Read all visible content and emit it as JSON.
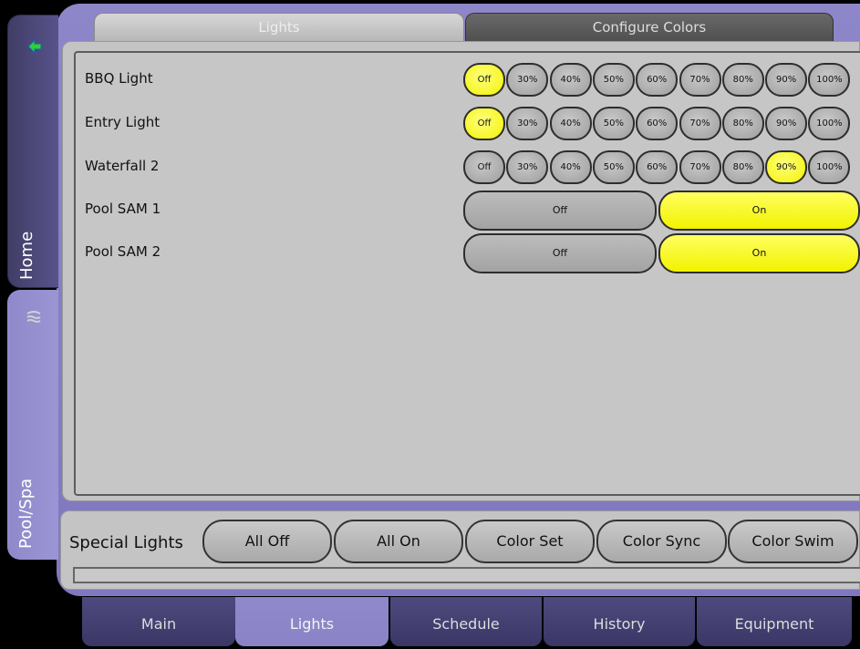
{
  "sidebar": {
    "home_label": "Home",
    "pool_label": "Pool/Spa",
    "home_icon": "arrow-icon",
    "pool_icon": "pool-icon"
  },
  "tabs": {
    "lights": "Lights",
    "configure_colors": "Configure Colors"
  },
  "lights": [
    {
      "name": "BBQ Light",
      "type": "dimmer",
      "options": [
        "Off",
        "30%",
        "40%",
        "50%",
        "60%",
        "70%",
        "80%",
        "90%",
        "100%"
      ],
      "selected": "Off"
    },
    {
      "name": "Entry Light",
      "type": "dimmer",
      "options": [
        "Off",
        "30%",
        "40%",
        "50%",
        "60%",
        "70%",
        "80%",
        "90%",
        "100%"
      ],
      "selected": "Off"
    },
    {
      "name": "Waterfall 2",
      "type": "dimmer",
      "options": [
        "Off",
        "30%",
        "40%",
        "50%",
        "60%",
        "70%",
        "80%",
        "90%",
        "100%"
      ],
      "selected": "90%"
    },
    {
      "name": "Pool SAM 1",
      "type": "switch",
      "options": [
        "Off",
        "On"
      ],
      "selected": "On"
    },
    {
      "name": "Pool SAM 2",
      "type": "switch",
      "options": [
        "Off",
        "On"
      ],
      "selected": "On"
    }
  ],
  "special": {
    "label": "Special Lights",
    "buttons": [
      "All Off",
      "All On",
      "Color Set",
      "Color Sync",
      "Color Swim"
    ]
  },
  "bottom_tabs": [
    "Main",
    "Lights",
    "Schedule",
    "History",
    "Equipment"
  ],
  "active_bottom_tab": "Lights",
  "colors": {
    "frame": "#8d86c8",
    "selected": "#f2f200",
    "panel": "#c4c4c4"
  }
}
